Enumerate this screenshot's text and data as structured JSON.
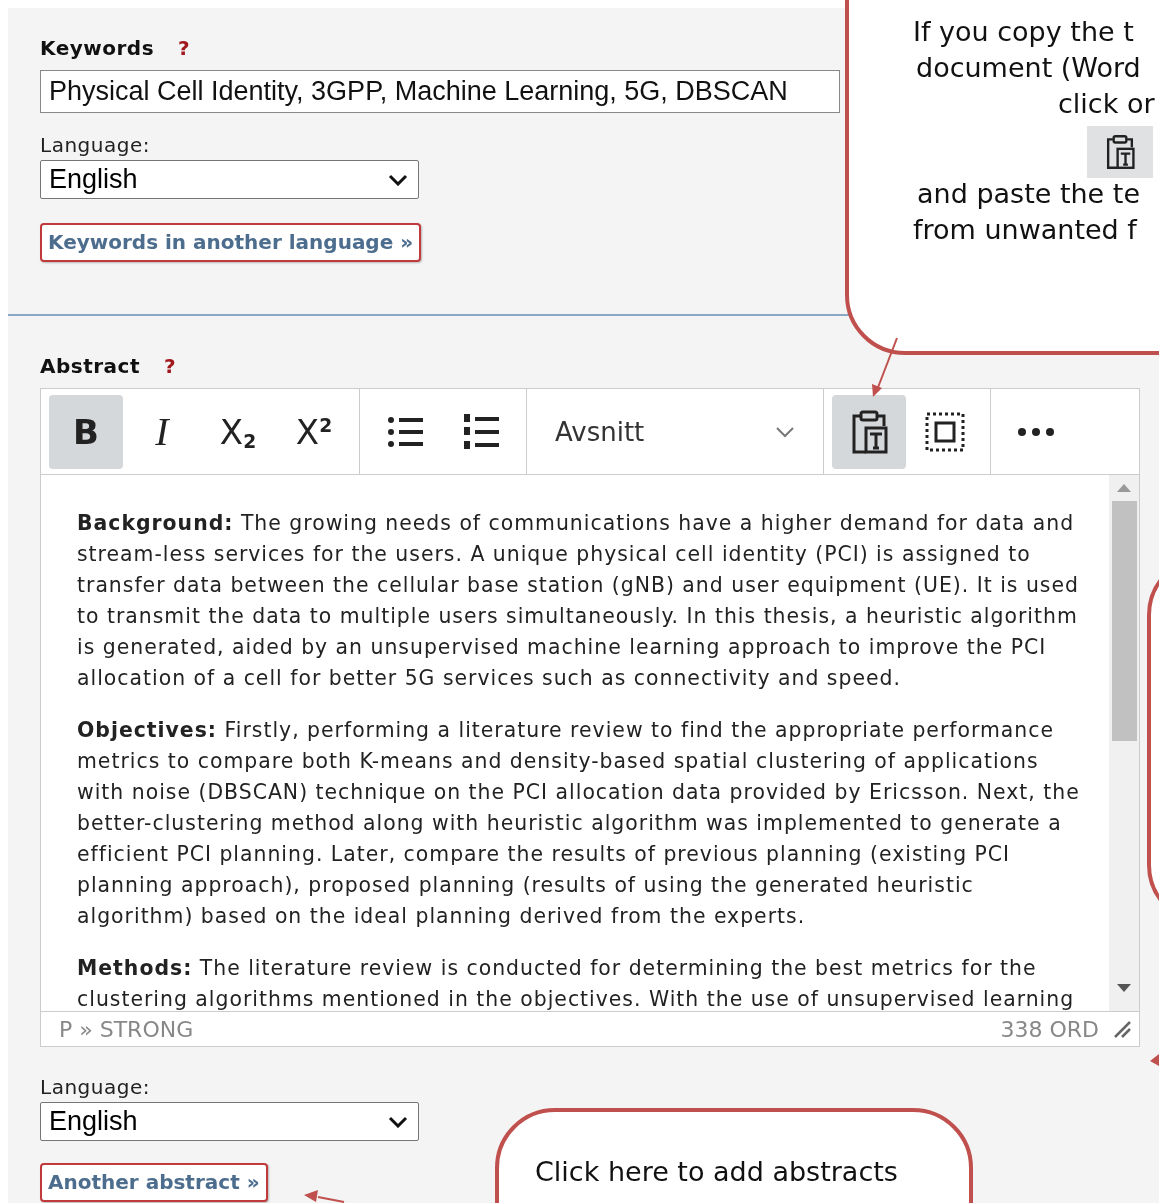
{
  "keywords": {
    "label": "Keywords",
    "help": "?",
    "value": "Physical Cell Identity, 3GPP, Machine Learning, 5G, DBSCAN",
    "language_label": "Language:",
    "language": "English",
    "more_button": "Keywords in another language »"
  },
  "abstract": {
    "label": "Abstract",
    "help": "?",
    "toolbar": [
      [
        {
          "kind": "bold",
          "label": "B",
          "selected": true
        },
        {
          "kind": "italic",
          "label": "I",
          "selected": false
        },
        {
          "kind": "subscript",
          "label": "X$_{2}$",
          "selected": false
        },
        {
          "kind": "superscript",
          "label": "X$^{2}$",
          "selected": false
        }
      ],
      [
        {
          "kind": "bullet-list",
          "selected": false
        },
        {
          "kind": "numbered-list",
          "selected": false
        }
      ],
      [
        {
          "kind": "dropdown",
          "label": "Avsnitt"
        }
      ],
      [
        {
          "kind": "paste-text",
          "selected": true
        },
        {
          "kind": "select-all",
          "selected": false
        }
      ],
      [
        {
          "kind": "more",
          "selected": false
        }
      ]
    ],
    "paragraphs": [
      "**Background:** The growing needs of communications have a higher demand for data and stream-less services for the users. A unique physical cell identity (PCI) is assigned to transfer data between the cellular base station (gNB) and user equipment (UE). It is used to transmit the data to multiple users simultaneously. In this thesis, a heuristic algorithm is generated, aided by an unsupervised machine learning approach to improve the PCI allocation of a cell for better 5G services such as connectivity and speed.",
      "**Objectives:** Firstly, performing a literature review to find the appropriate performance metrics to compare both K-means and density-based spatial clustering of applications with noise (DBSCAN) technique on the PCI allocation data provided by Ericsson. Next, the better-clustering method along with heuristic algorithm was implemented to generate a efficient PCI planning. Later, compare the results of previous planning (existing PCI planning approach), proposed planning (results of using the generated heuristic algorithm) based on the ideal planning derived from the experts.",
      "**Methods:** The literature review is conducted for determining the best metrics for the clustering algorithms mentioned in the objectives. With the use of unsupervised learning"
    ],
    "path": "P » STRONG",
    "word_count": "338 ORD",
    "language_label": "Language:",
    "language": "English",
    "more_button": "Another abstract »"
  },
  "callouts": [
    {
      "kind": "bubble",
      "lines": [
        {
          "kind": "text",
          "text": "If you copy the t"
        },
        {
          "kind": "text",
          "text": "document (Word"
        },
        {
          "kind": "text",
          "text": "click or"
        },
        {
          "kind": "paste-icon"
        },
        {
          "kind": "text",
          "text": "and paste the te"
        },
        {
          "kind": "text",
          "text": "from unwanted f"
        }
      ]
    },
    {
      "kind": "bubble"
    },
    {
      "kind": "bubble",
      "lines": [
        {
          "kind": "text",
          "text": "Click here to add abstracts"
        }
      ]
    }
  ]
}
